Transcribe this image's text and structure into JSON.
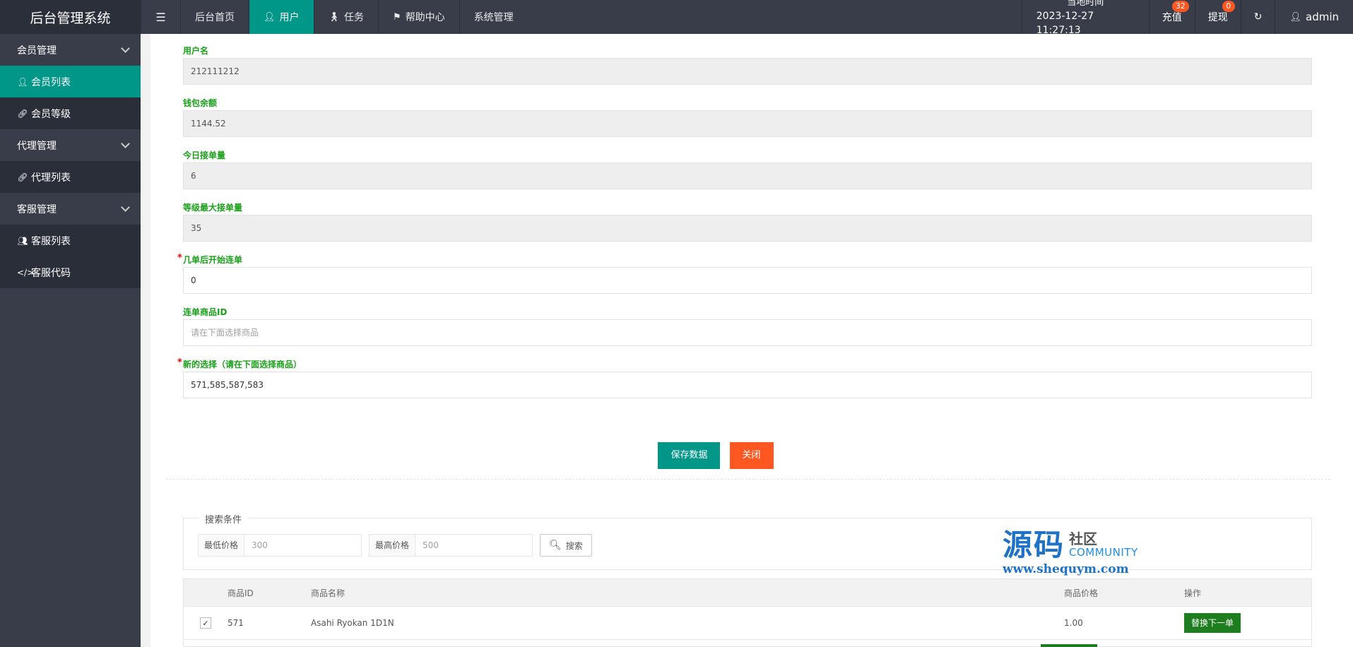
{
  "app": {
    "title": "后台管理系统"
  },
  "header": {
    "nav": [
      {
        "label": "后台首页",
        "icon": ""
      },
      {
        "label": "用户",
        "icon": "user-icon",
        "active": true
      },
      {
        "label": "任务",
        "icon": "walk-icon"
      },
      {
        "label": "帮助中心",
        "icon": "flag-icon"
      },
      {
        "label": "系统管理",
        "icon": ""
      }
    ],
    "clock_label": "当地时间",
    "clock_value": "2023-12-27 11:27:13",
    "recharge_label": "充值",
    "recharge_badge": "32",
    "withdraw_label": "提现",
    "withdraw_badge": "0",
    "admin_label": "admin"
  },
  "sidebar": {
    "groups": [
      {
        "label": "会员管理",
        "items": [
          {
            "label": "会员列表",
            "icon": "user-icon",
            "active": true
          },
          {
            "label": "会员等级",
            "icon": "link-icon"
          }
        ]
      },
      {
        "label": "代理管理",
        "items": [
          {
            "label": "代理列表",
            "icon": "link-icon"
          }
        ]
      },
      {
        "label": "客服管理",
        "items": [
          {
            "label": "客服列表",
            "icon": "users-icon"
          },
          {
            "label": "客服代码",
            "icon": "code-icon"
          }
        ]
      }
    ]
  },
  "form": {
    "username": {
      "label": "用户名",
      "value": "212111212"
    },
    "balance": {
      "label": "钱包余额",
      "value": "1144.52"
    },
    "today_orders": {
      "label": "今日接单量",
      "value": "6"
    },
    "max_orders": {
      "label": "等级最大接单量",
      "value": "35"
    },
    "start_after": {
      "label": "几单后开始连单",
      "value": "0"
    },
    "product_id": {
      "label": "连单商品ID",
      "value": "",
      "placeholder": "请在下面选择商品"
    },
    "new_choice": {
      "label": "新的选择（请在下面选择商品）",
      "value": "571,585,587,583"
    },
    "save_label": "保存数据",
    "close_label": "关闭"
  },
  "search": {
    "legend": "搜索条件",
    "min_label": "最低价格",
    "min_placeholder": "300",
    "max_label": "最高价格",
    "max_placeholder": "500",
    "button_label": "搜索"
  },
  "table": {
    "headers": {
      "id": "商品ID",
      "name": "商品名称",
      "price": "商品价格",
      "op": "操作"
    },
    "rows": [
      {
        "checked": true,
        "id": "571",
        "name": "Asahi Ryokan 1D1N",
        "price": "1.00",
        "action": "替换下一单"
      }
    ]
  },
  "watermark": {
    "big": "源码",
    "side_cn": "社区",
    "side_en": "COMMUNITY",
    "url": "www.shequym.com"
  },
  "colors": {
    "header_bg": "#393d49",
    "accent": "#009688",
    "danger": "#ff5722",
    "label_green": "#1aa01a",
    "action_green": "#1e7d1e"
  }
}
